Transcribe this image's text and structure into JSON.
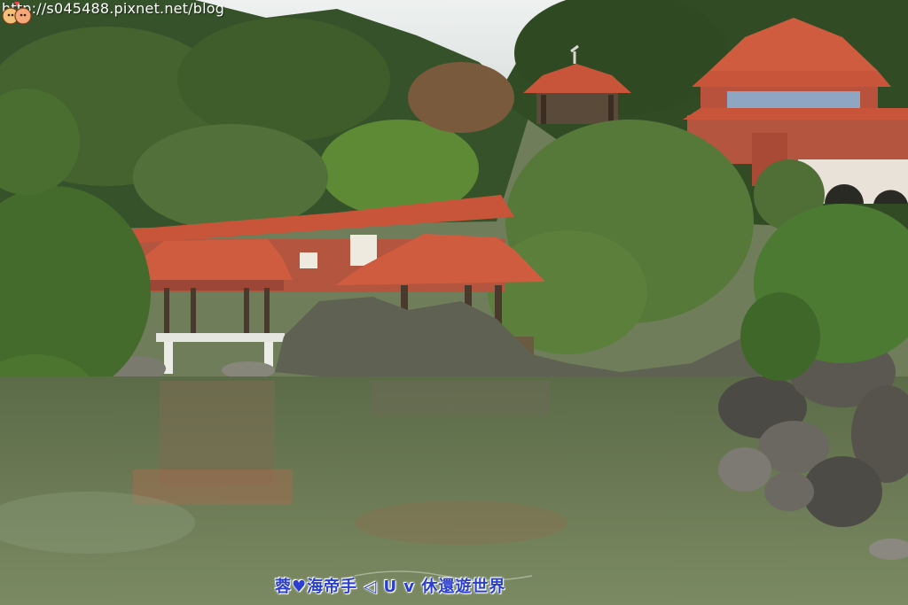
{
  "photo": {
    "watermark_url": "http://s045488.pixnet.net/blog",
    "watermark_signature": "蓉♥海帝手 ◁ U v 休還遊世界"
  },
  "palette": {
    "sky": "#dfe6e6",
    "forest_dark": "#2f4a22",
    "forest_mid": "#4f6b32",
    "roof_tile": "#c8553a",
    "brick_wall": "#b4553f",
    "water": "#6b7a56"
  },
  "icons": {
    "mascot": "cartoon-mascot-icon"
  }
}
